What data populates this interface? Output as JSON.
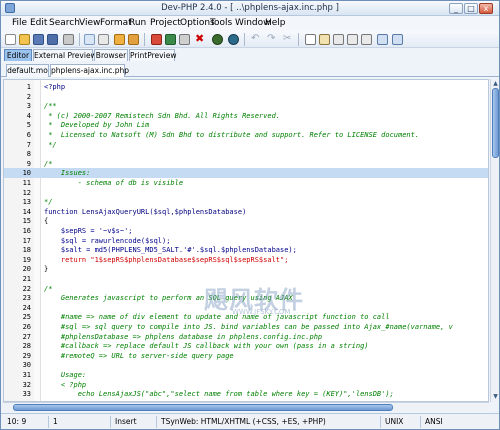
{
  "window": {
    "title": "Dev-PHP 2.4.0 - [ ..\\phplens-ajax.inc.php ]",
    "min": "_",
    "max": "□",
    "close": "x"
  },
  "menu": [
    "File",
    "Edit",
    "Search",
    "View",
    "Format",
    "Run",
    "Project",
    "Options",
    "Tools",
    "Window",
    "Help"
  ],
  "toolbar": {
    "icons": [
      "new-icon",
      "open-icon",
      "save-icon",
      "save-all-icon",
      "print-icon",
      "close-file-icon",
      "run-icon",
      "stop-icon",
      "debug-icon",
      "bug-icon",
      "undo-icon",
      "redo-icon",
      "cut-icon",
      "copy-icon",
      "paste-icon",
      "find-icon",
      "replace-icon"
    ]
  },
  "main_tabs": [
    "Editor",
    "External Preview",
    "Browser",
    "PrintPreview"
  ],
  "file_tabs": [
    "default.mo",
    "phplens-ajax.inc.php"
  ],
  "code": [
    {
      "n": "1",
      "t": "<?php",
      "cls": "k"
    },
    {
      "n": "2",
      "t": "",
      "cls": "p"
    },
    {
      "n": "3",
      "t": "/**",
      "cls": "c"
    },
    {
      "n": "4",
      "t": " * (c) 2000-2007 Remistech Sdn Bhd. All Rights Reserved.",
      "cls": "c"
    },
    {
      "n": "5",
      "t": " *  Developed by John Lim",
      "cls": "c"
    },
    {
      "n": "6",
      "t": " *  Licensed to Natsoft (M) Sdn Bhd to distribute and support. Refer to LICENSE document.",
      "cls": "c"
    },
    {
      "n": "7",
      "t": " */",
      "cls": "c"
    },
    {
      "n": "8",
      "t": "",
      "cls": "p"
    },
    {
      "n": "9",
      "t": "/*",
      "cls": "c"
    },
    {
      "n": "10",
      "t": "    Issues:",
      "cls": "c"
    },
    {
      "n": "11",
      "t": "        - schema of db is visible",
      "cls": "c"
    },
    {
      "n": "12",
      "t": "",
      "cls": "p"
    },
    {
      "n": "13",
      "t": "*/",
      "cls": "c"
    },
    {
      "n": "14",
      "t": "function LensAjaxQueryURL($sql,$phplensDatabase)",
      "cls": "k"
    },
    {
      "n": "15",
      "t": "{",
      "cls": "p"
    },
    {
      "n": "16",
      "t": "    $sepRS = '~v$s~';",
      "cls": "v"
    },
    {
      "n": "17",
      "t": "    $sql = rawurlencode($sql);",
      "cls": "v"
    },
    {
      "n": "18",
      "t": "    $salt = md5(PHPLENS_MD5_SALT.'#'.$sql.$phplensDatabase);",
      "cls": "v"
    },
    {
      "n": "19",
      "t": "    return \"1$sepRS$phplensDatabase$sepRS$sql$sepRS$salt\";",
      "cls": "s"
    },
    {
      "n": "20",
      "t": "}",
      "cls": "p"
    },
    {
      "n": "21",
      "t": "",
      "cls": "p"
    },
    {
      "n": "22",
      "t": "/*",
      "cls": "c"
    },
    {
      "n": "23",
      "t": "    Generates javascript to perform an SQL query using AJAX",
      "cls": "c"
    },
    {
      "n": "24",
      "t": "",
      "cls": "p"
    },
    {
      "n": "25",
      "t": "    #name => name of div element to update and name of javascript function to call",
      "cls": "c"
    },
    {
      "n": "26",
      "t": "    #sql => sql query to compile into JS. bind variables can be passed into Ajax_#name(varname, v",
      "cls": "c"
    },
    {
      "n": "27",
      "t": "    #phplensDatabase => phplens database in phplens.config.inc.php",
      "cls": "c"
    },
    {
      "n": "28",
      "t": "    #callback => replace default JS callback with your own (pass in a string)",
      "cls": "c"
    },
    {
      "n": "29",
      "t": "    #remoteQ => URL to server-side query page",
      "cls": "c"
    },
    {
      "n": "30",
      "t": "",
      "cls": "p"
    },
    {
      "n": "31",
      "t": "    Usage:",
      "cls": "c"
    },
    {
      "n": "32",
      "t": "    < ?php",
      "cls": "c"
    },
    {
      "n": "33",
      "t": "        echo LensAjaxJS(\"abc\",\"select name from table where key = (KEY)\",'lensDB');",
      "cls": "c"
    }
  ],
  "highlighted_line": "10",
  "status": {
    "pos": "10:   9",
    "modified": "1",
    "mode": "Insert",
    "syntax": "TSynWeb: HTML/XHTML (+CSS, +ES, +PHP)",
    "eol": "UNIX",
    "encoding": "ANSI"
  },
  "watermark": {
    "main": "飓风软件",
    "sub": "WWW.JFSKY.COM"
  }
}
